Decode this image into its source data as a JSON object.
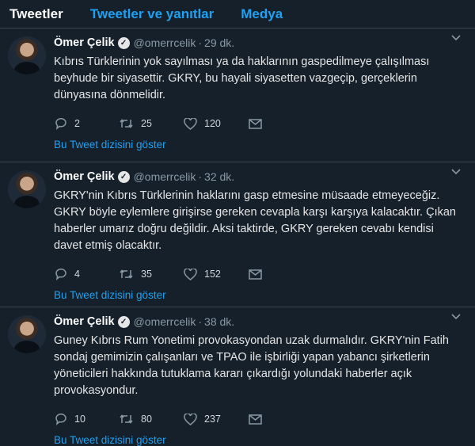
{
  "tabs": [
    {
      "label": "Tweetler"
    },
    {
      "label": "Tweetler ve yanıtlar"
    },
    {
      "label": "Medya"
    }
  ],
  "tweets": [
    {
      "name": "Ömer Çelik",
      "handle": "@omerrcelik",
      "dot": "·",
      "time": "29 dk.",
      "text": "Kıbrıs Türklerinin yok sayılması ya da haklarının gaspedilmeye çalışılması beyhude bir siyasettir. GKRY, bu hayali siyasetten vazgeçip, gerçeklerin dünyasına dönmelidir.",
      "replies": "2",
      "retweets": "25",
      "likes": "120",
      "thread_link": "Bu Tweet dizisini göster"
    },
    {
      "name": "Ömer Çelik",
      "handle": "@omerrcelik",
      "dot": "·",
      "time": "32 dk.",
      "text": "GKRY'nin Kıbrıs Türklerinin haklarını gasp etmesine müsaade etmeyeceğiz. GKRY böyle eylemlere girişirse gereken cevapla karşı karşıya kalacaktır. Çıkan haberler umarız doğru değildir. Aksi taktirde, GKRY gereken cevabı kendisi davet etmiş olacaktır.",
      "replies": "4",
      "retweets": "35",
      "likes": "152",
      "thread_link": "Bu Tweet dizisini göster"
    },
    {
      "name": "Ömer Çelik",
      "handle": "@omerrcelik",
      "dot": "·",
      "time": "38 dk.",
      "text": "Guney Kıbrıs Rum Yonetimi provokasyondan uzak durmalıdır. GKRY'nin Fatih sondaj gemimizin çalışanları ve TPAO ile işbirliği yapan yabancı şirketlerin yöneticileri hakkında tutuklama kararı çıkardığı yolundaki haberler açık provokasyondur.",
      "replies": "10",
      "retweets": "80",
      "likes": "237",
      "thread_link": "Bu Tweet dizisini göster"
    }
  ],
  "colors": {
    "background": "#15202b",
    "link": "#1da1f2",
    "muted": "#8899a6",
    "border": "#38444d"
  },
  "icons": [
    "verified-badge-icon",
    "chevron-down-icon",
    "reply-icon",
    "retweet-icon",
    "like-icon",
    "direct-message-icon"
  ]
}
